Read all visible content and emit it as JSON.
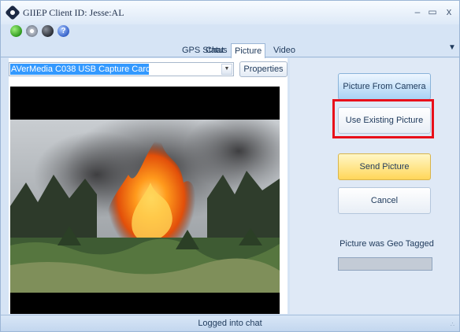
{
  "window": {
    "title": "GIIEP Client ID: Jesse:AL"
  },
  "window_controls": {
    "minimize": "–",
    "maximize": "▭",
    "close": "x"
  },
  "toolbar": {
    "icons": [
      "connect-icon",
      "settings-icon",
      "disconnect-icon",
      "help-icon"
    ],
    "help_glyph": "?"
  },
  "tabs": [
    {
      "label": "GPS Status",
      "selected": false
    },
    {
      "label": "Chat",
      "selected": false
    },
    {
      "label": "Picture",
      "selected": true
    },
    {
      "label": "Video",
      "selected": false
    }
  ],
  "picture": {
    "device_select": {
      "value": "AVerMedia C038 USB Capture Card"
    },
    "properties_label": "Properties",
    "preview_icon": "live-video-frame"
  },
  "actions": {
    "picture_from_camera": "Picture From Camera",
    "use_existing_picture": "Use Existing Picture",
    "send_picture": "Send Picture",
    "cancel": "Cancel"
  },
  "geo": {
    "label": "Picture was Geo Tagged",
    "progress": 0
  },
  "status": {
    "text": "Logged into chat"
  },
  "colors": {
    "highlight": "#e8101a",
    "selection": "#3399ff",
    "send_button": "#ffd659",
    "camera_button": "#a9d2f4"
  }
}
